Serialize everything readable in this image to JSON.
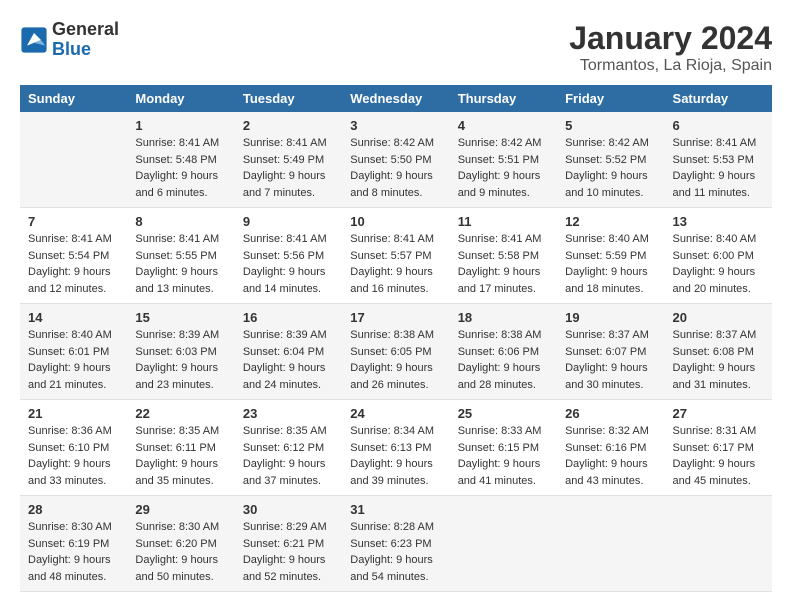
{
  "logo": {
    "general": "General",
    "blue": "Blue"
  },
  "title": "January 2024",
  "location": "Tormantos, La Rioja, Spain",
  "headers": [
    "Sunday",
    "Monday",
    "Tuesday",
    "Wednesday",
    "Thursday",
    "Friday",
    "Saturday"
  ],
  "weeks": [
    {
      "days": [
        {
          "number": "",
          "sunrise": "",
          "sunset": "",
          "daylight": ""
        },
        {
          "number": "1",
          "sunrise": "Sunrise: 8:41 AM",
          "sunset": "Sunset: 5:48 PM",
          "daylight": "Daylight: 9 hours and 6 minutes."
        },
        {
          "number": "2",
          "sunrise": "Sunrise: 8:41 AM",
          "sunset": "Sunset: 5:49 PM",
          "daylight": "Daylight: 9 hours and 7 minutes."
        },
        {
          "number": "3",
          "sunrise": "Sunrise: 8:42 AM",
          "sunset": "Sunset: 5:50 PM",
          "daylight": "Daylight: 9 hours and 8 minutes."
        },
        {
          "number": "4",
          "sunrise": "Sunrise: 8:42 AM",
          "sunset": "Sunset: 5:51 PM",
          "daylight": "Daylight: 9 hours and 9 minutes."
        },
        {
          "number": "5",
          "sunrise": "Sunrise: 8:42 AM",
          "sunset": "Sunset: 5:52 PM",
          "daylight": "Daylight: 9 hours and 10 minutes."
        },
        {
          "number": "6",
          "sunrise": "Sunrise: 8:41 AM",
          "sunset": "Sunset: 5:53 PM",
          "daylight": "Daylight: 9 hours and 11 minutes."
        }
      ]
    },
    {
      "days": [
        {
          "number": "7",
          "sunrise": "Sunrise: 8:41 AM",
          "sunset": "Sunset: 5:54 PM",
          "daylight": "Daylight: 9 hours and 12 minutes."
        },
        {
          "number": "8",
          "sunrise": "Sunrise: 8:41 AM",
          "sunset": "Sunset: 5:55 PM",
          "daylight": "Daylight: 9 hours and 13 minutes."
        },
        {
          "number": "9",
          "sunrise": "Sunrise: 8:41 AM",
          "sunset": "Sunset: 5:56 PM",
          "daylight": "Daylight: 9 hours and 14 minutes."
        },
        {
          "number": "10",
          "sunrise": "Sunrise: 8:41 AM",
          "sunset": "Sunset: 5:57 PM",
          "daylight": "Daylight: 9 hours and 16 minutes."
        },
        {
          "number": "11",
          "sunrise": "Sunrise: 8:41 AM",
          "sunset": "Sunset: 5:58 PM",
          "daylight": "Daylight: 9 hours and 17 minutes."
        },
        {
          "number": "12",
          "sunrise": "Sunrise: 8:40 AM",
          "sunset": "Sunset: 5:59 PM",
          "daylight": "Daylight: 9 hours and 18 minutes."
        },
        {
          "number": "13",
          "sunrise": "Sunrise: 8:40 AM",
          "sunset": "Sunset: 6:00 PM",
          "daylight": "Daylight: 9 hours and 20 minutes."
        }
      ]
    },
    {
      "days": [
        {
          "number": "14",
          "sunrise": "Sunrise: 8:40 AM",
          "sunset": "Sunset: 6:01 PM",
          "daylight": "Daylight: 9 hours and 21 minutes."
        },
        {
          "number": "15",
          "sunrise": "Sunrise: 8:39 AM",
          "sunset": "Sunset: 6:03 PM",
          "daylight": "Daylight: 9 hours and 23 minutes."
        },
        {
          "number": "16",
          "sunrise": "Sunrise: 8:39 AM",
          "sunset": "Sunset: 6:04 PM",
          "daylight": "Daylight: 9 hours and 24 minutes."
        },
        {
          "number": "17",
          "sunrise": "Sunrise: 8:38 AM",
          "sunset": "Sunset: 6:05 PM",
          "daylight": "Daylight: 9 hours and 26 minutes."
        },
        {
          "number": "18",
          "sunrise": "Sunrise: 8:38 AM",
          "sunset": "Sunset: 6:06 PM",
          "daylight": "Daylight: 9 hours and 28 minutes."
        },
        {
          "number": "19",
          "sunrise": "Sunrise: 8:37 AM",
          "sunset": "Sunset: 6:07 PM",
          "daylight": "Daylight: 9 hours and 30 minutes."
        },
        {
          "number": "20",
          "sunrise": "Sunrise: 8:37 AM",
          "sunset": "Sunset: 6:08 PM",
          "daylight": "Daylight: 9 hours and 31 minutes."
        }
      ]
    },
    {
      "days": [
        {
          "number": "21",
          "sunrise": "Sunrise: 8:36 AM",
          "sunset": "Sunset: 6:10 PM",
          "daylight": "Daylight: 9 hours and 33 minutes."
        },
        {
          "number": "22",
          "sunrise": "Sunrise: 8:35 AM",
          "sunset": "Sunset: 6:11 PM",
          "daylight": "Daylight: 9 hours and 35 minutes."
        },
        {
          "number": "23",
          "sunrise": "Sunrise: 8:35 AM",
          "sunset": "Sunset: 6:12 PM",
          "daylight": "Daylight: 9 hours and 37 minutes."
        },
        {
          "number": "24",
          "sunrise": "Sunrise: 8:34 AM",
          "sunset": "Sunset: 6:13 PM",
          "daylight": "Daylight: 9 hours and 39 minutes."
        },
        {
          "number": "25",
          "sunrise": "Sunrise: 8:33 AM",
          "sunset": "Sunset: 6:15 PM",
          "daylight": "Daylight: 9 hours and 41 minutes."
        },
        {
          "number": "26",
          "sunrise": "Sunrise: 8:32 AM",
          "sunset": "Sunset: 6:16 PM",
          "daylight": "Daylight: 9 hours and 43 minutes."
        },
        {
          "number": "27",
          "sunrise": "Sunrise: 8:31 AM",
          "sunset": "Sunset: 6:17 PM",
          "daylight": "Daylight: 9 hours and 45 minutes."
        }
      ]
    },
    {
      "days": [
        {
          "number": "28",
          "sunrise": "Sunrise: 8:30 AM",
          "sunset": "Sunset: 6:19 PM",
          "daylight": "Daylight: 9 hours and 48 minutes."
        },
        {
          "number": "29",
          "sunrise": "Sunrise: 8:30 AM",
          "sunset": "Sunset: 6:20 PM",
          "daylight": "Daylight: 9 hours and 50 minutes."
        },
        {
          "number": "30",
          "sunrise": "Sunrise: 8:29 AM",
          "sunset": "Sunset: 6:21 PM",
          "daylight": "Daylight: 9 hours and 52 minutes."
        },
        {
          "number": "31",
          "sunrise": "Sunrise: 8:28 AM",
          "sunset": "Sunset: 6:23 PM",
          "daylight": "Daylight: 9 hours and 54 minutes."
        },
        {
          "number": "",
          "sunrise": "",
          "sunset": "",
          "daylight": ""
        },
        {
          "number": "",
          "sunrise": "",
          "sunset": "",
          "daylight": ""
        },
        {
          "number": "",
          "sunrise": "",
          "sunset": "",
          "daylight": ""
        }
      ]
    }
  ]
}
